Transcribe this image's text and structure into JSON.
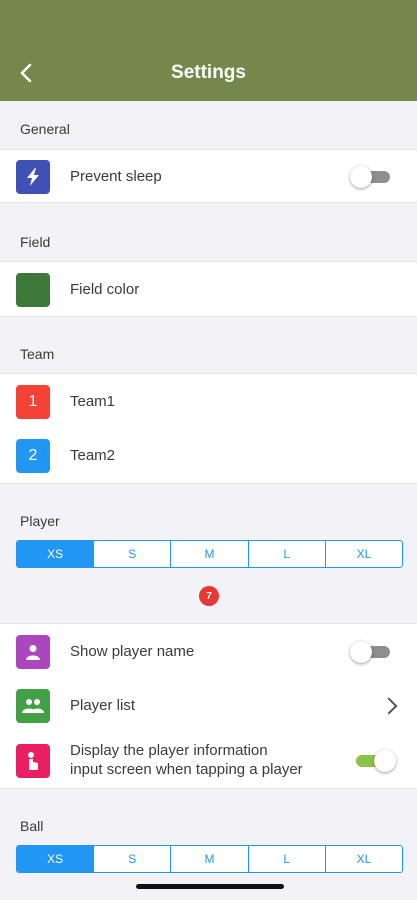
{
  "header": {
    "title": "Settings",
    "back_icon": "chevron-left-icon"
  },
  "sections": {
    "general": "General",
    "field": "Field",
    "team": "Team",
    "player": "Player",
    "ball": "Ball"
  },
  "general": {
    "prevent_sleep": {
      "label": "Prevent sleep",
      "icon": "bolt-icon",
      "icon_color": "#3f51b5",
      "enabled": false
    }
  },
  "field": {
    "field_color": {
      "label": "Field color",
      "swatch_color": "#3d7a3a"
    }
  },
  "team": {
    "team1": {
      "number": "1",
      "label": "Team1",
      "color": "#f44336"
    },
    "team2": {
      "number": "2",
      "label": "Team2",
      "color": "#2196f3"
    }
  },
  "player": {
    "sizes": [
      "XS",
      "S",
      "M",
      "L",
      "XL"
    ],
    "selected_size": "XS",
    "badge_number": "7",
    "badge_color": "#e53935",
    "show_name": {
      "label": "Show player name",
      "icon": "person-icon",
      "icon_color": "#ab47bc",
      "enabled": false
    },
    "player_list": {
      "label": "Player list",
      "icon": "group-icon",
      "icon_color": "#43a047"
    },
    "display_info": {
      "label_line1": "Display the player information",
      "label_line2": "input screen when tapping a player",
      "icon": "tap-hand-icon",
      "icon_color": "#e91e63",
      "enabled": true
    }
  },
  "ball": {
    "sizes": [
      "XS",
      "S",
      "M",
      "L",
      "XL"
    ],
    "selected_size": "XS"
  },
  "colors": {
    "header": "#74884b",
    "accent": "#2196f3",
    "toggle_on": "#8bc34a"
  }
}
